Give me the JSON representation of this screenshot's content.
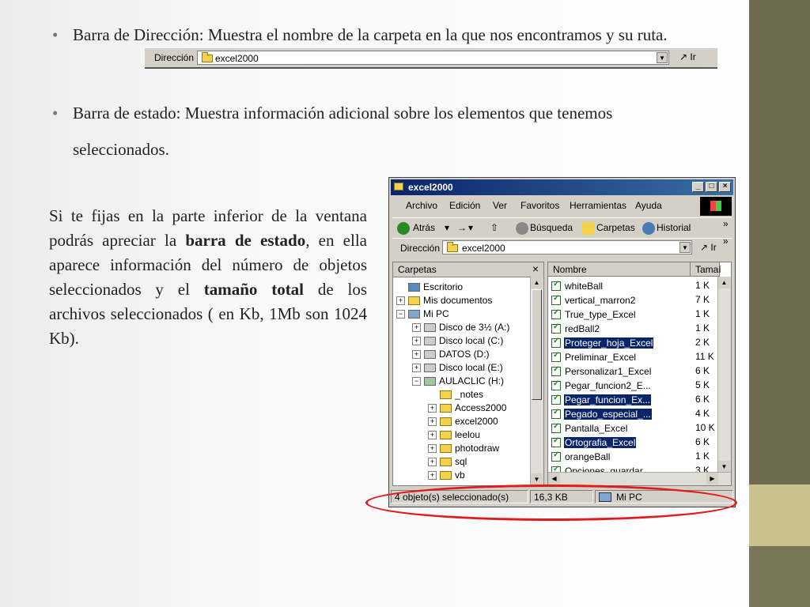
{
  "bullets": {
    "b1_text": "Barra de Dirección: Muestra el nombre de la carpeta en la que nos encontramos y su ruta.",
    "b2_text": "Barra de estado: Muestra información adicional sobre los elementos que tenemos",
    "b2_line2": "seleccionados.",
    "bullet_glyph": "•"
  },
  "address_strip": {
    "label": "Dirección",
    "value": "excel2000",
    "go_label": "Ir"
  },
  "paragraph": {
    "p1": "Si te fijas en la parte inferior de la ventana podrás apreciar la ",
    "bold1": "barra de estado",
    "p2": ", en ella aparece información del número de objetos seleccionados y el ",
    "bold2": "tamaño total",
    "p3": " de los archivos seleccionados ( en Kb, 1Mb son 1024 Kb)."
  },
  "window": {
    "title": "excel2000",
    "menu": [
      "Archivo",
      "Edición",
      "Ver",
      "Favoritos",
      "Herramientas",
      "Ayuda"
    ],
    "toolbar": {
      "back": "Atrás",
      "search": "Búsqueda",
      "folders": "Carpetas",
      "history": "Historial",
      "more": "»"
    },
    "address": {
      "label": "Dirección",
      "value": "excel2000",
      "go_label": "Ir",
      "more": "»"
    },
    "tree_header": "Carpetas",
    "tree": [
      {
        "label": "Escritorio",
        "icon": "desktop-icon",
        "pm": ""
      },
      {
        "label": "Mis documentos",
        "icon": "folder-icon",
        "pm": "+"
      },
      {
        "label": "Mi PC",
        "icon": "computer-icon",
        "pm": "−"
      },
      {
        "label": "Disco de 3½ (A:)",
        "icon": "floppy-icon",
        "pm": "+"
      },
      {
        "label": "Disco local (C:)",
        "icon": "drive-icon",
        "pm": "+"
      },
      {
        "label": "DATOS (D:)",
        "icon": "drive-icon",
        "pm": "+"
      },
      {
        "label": "Disco local (E:)",
        "icon": "drive-icon",
        "pm": "+"
      },
      {
        "label": "AULACLIC (H:)",
        "icon": "network-drive-icon",
        "pm": "−"
      },
      {
        "label": "_notes",
        "icon": "folder-icon",
        "pm": ""
      },
      {
        "label": "Access2000",
        "icon": "folder-icon",
        "pm": "+"
      },
      {
        "label": "excel2000",
        "icon": "folder-icon",
        "pm": "+"
      },
      {
        "label": "leelou",
        "icon": "folder-icon",
        "pm": "+"
      },
      {
        "label": "photodraw",
        "icon": "folder-icon",
        "pm": "+"
      },
      {
        "label": "sql",
        "icon": "folder-icon",
        "pm": "+"
      },
      {
        "label": "vb",
        "icon": "folder-icon",
        "pm": "+"
      }
    ],
    "columns": {
      "name": "Nombre",
      "size": "Tamaí"
    },
    "files": [
      {
        "name": "whiteBall",
        "size": "1 K",
        "selected": false
      },
      {
        "name": "vertical_marron2",
        "size": "7 K",
        "selected": false
      },
      {
        "name": "True_type_Excel",
        "size": "1 K",
        "selected": false
      },
      {
        "name": "redBall2",
        "size": "1 K",
        "selected": false
      },
      {
        "name": "Proteger_hoja_Excel",
        "size": "2 K",
        "selected": true
      },
      {
        "name": "Preliminar_Excel",
        "size": "11 K",
        "selected": false
      },
      {
        "name": "Personalizar1_Excel",
        "size": "6 K",
        "selected": false
      },
      {
        "name": "Pegar_funcion2_E...",
        "size": "5 K",
        "selected": false
      },
      {
        "name": "Pegar_funcion_Ex...",
        "size": "6 K",
        "selected": true
      },
      {
        "name": "Pegado_especial_...",
        "size": "4 K",
        "selected": true
      },
      {
        "name": "Pantalla_Excel",
        "size": "10 K",
        "selected": false
      },
      {
        "name": "Ortografia_Excel",
        "size": "6 K",
        "selected": true
      },
      {
        "name": "orangeBall",
        "size": "1 K",
        "selected": false
      },
      {
        "name": "Opciones_guardar",
        "size": "3 K",
        "selected": false
      }
    ],
    "status": {
      "objects": "4 objeto(s) seleccionado(s)",
      "size": "16,3 KB",
      "location": "Mi PC"
    }
  },
  "colors": {
    "highlight": "#e01b1b",
    "sidebar": "#6e6a4e",
    "selection": "#0a246a"
  }
}
